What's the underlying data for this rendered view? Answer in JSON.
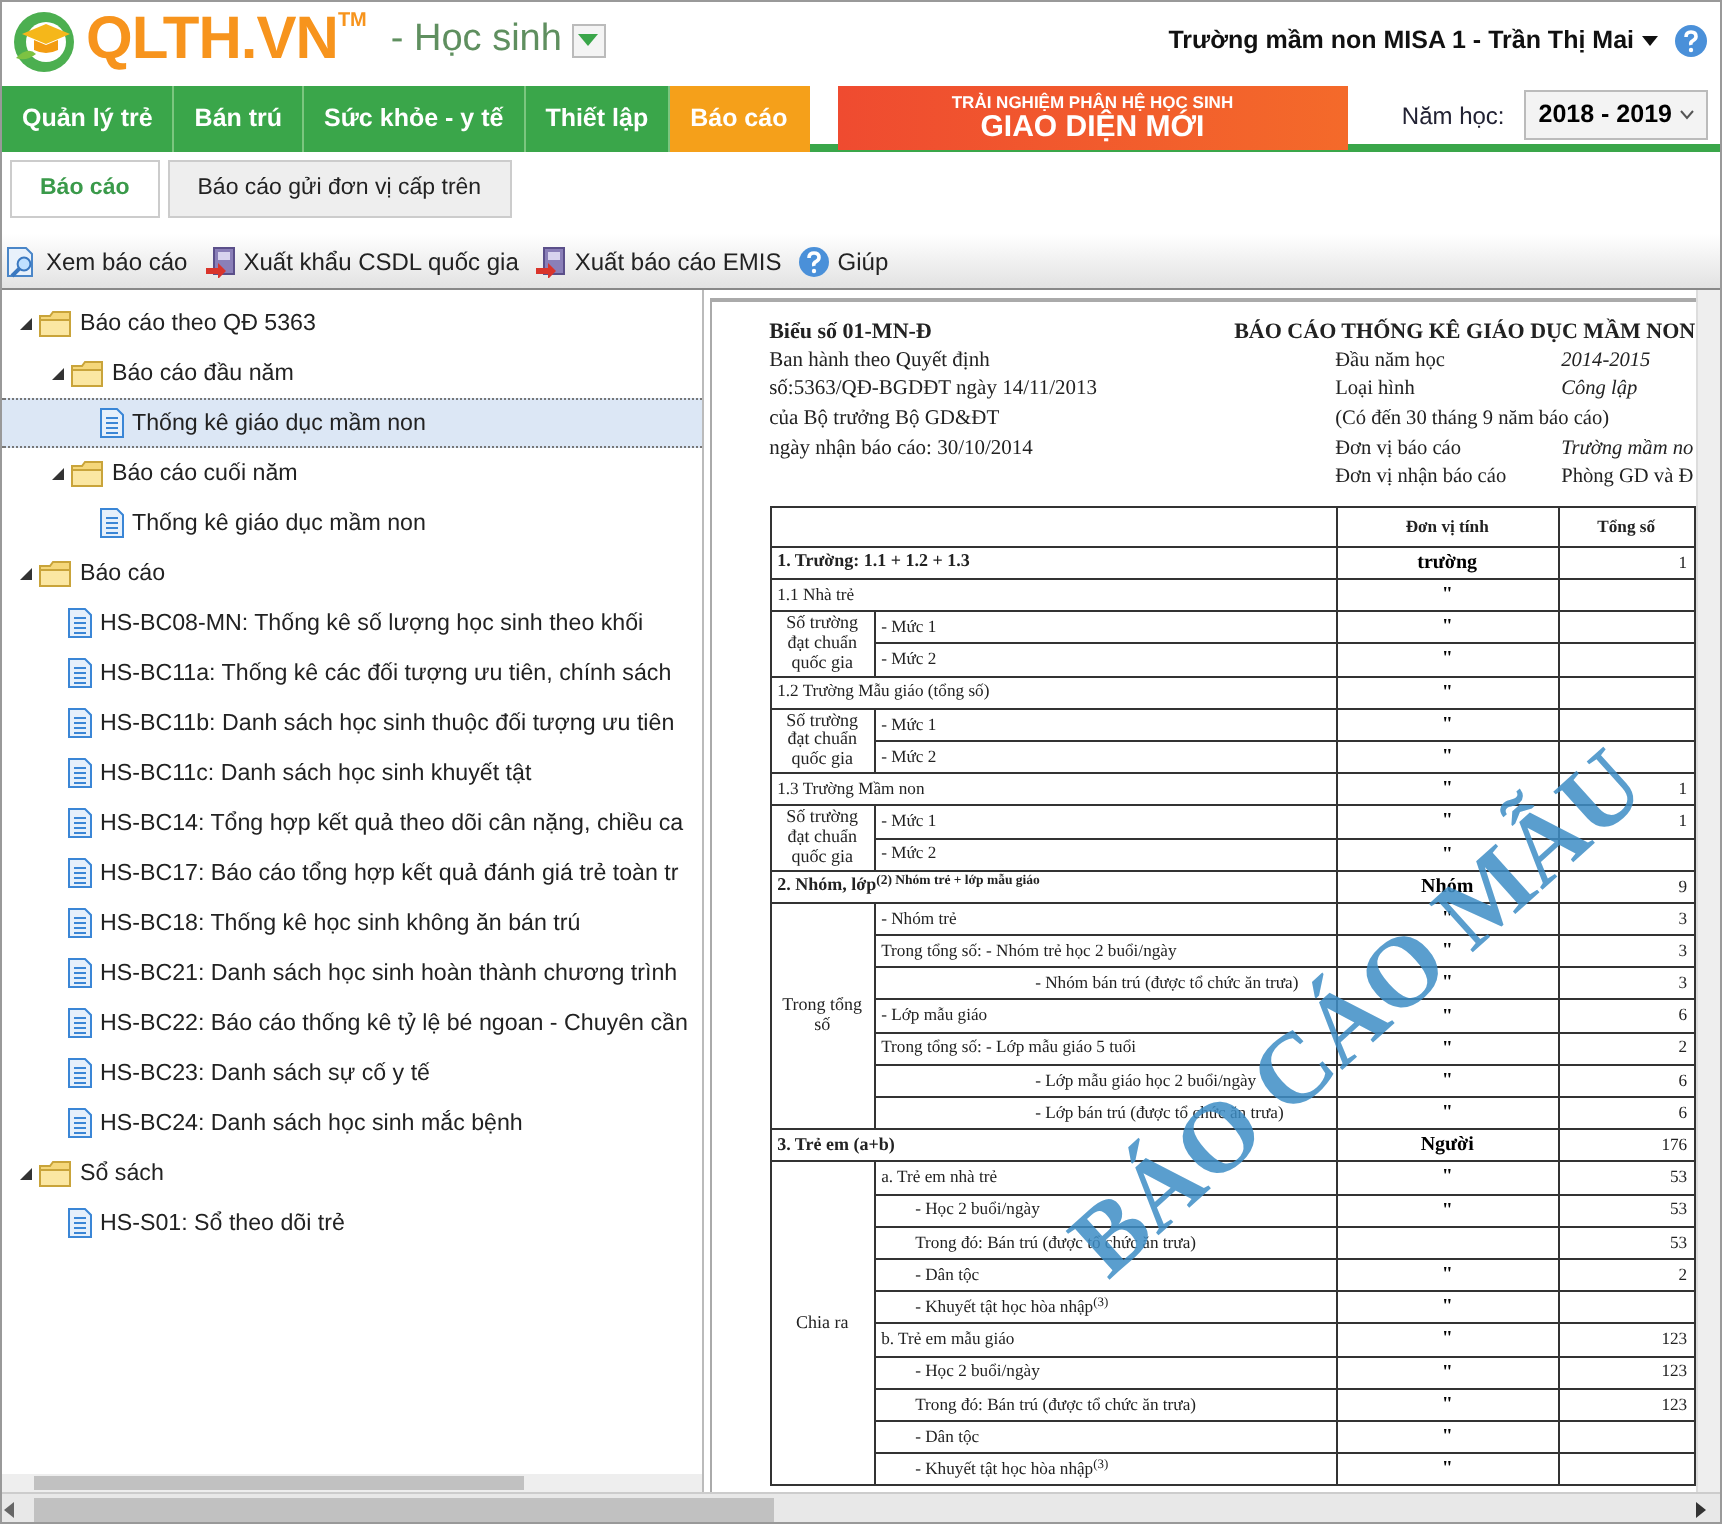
{
  "header": {
    "logo": "QLTH.VN",
    "trademark": "TM",
    "module": "- Học sinh",
    "user": "Trường mầm non MISA 1 - Trần Thị Mai"
  },
  "nav_tabs": [
    {
      "label": "Quản lý trẻ",
      "selected": false
    },
    {
      "label": "Bán trú",
      "selected": false
    },
    {
      "label": "Sức khỏe - y tế",
      "selected": false
    },
    {
      "label": "Thiết lập",
      "selected": false
    },
    {
      "label": "Báo cáo",
      "selected": true
    }
  ],
  "banner": {
    "line_1": "TRẢI NGHIỆM PHÂN HỆ HỌC SINH",
    "line_2": "GIAO DIỆN MỚI"
  },
  "school_year": {
    "label": "Năm học:",
    "value": "2018 - 2019"
  },
  "sub_tabs": [
    {
      "label": "Báo cáo",
      "selected": true
    },
    {
      "label": "Báo cáo gửi đơn vị cấp trên",
      "selected": false
    }
  ],
  "toolbar": [
    {
      "label": "Xem báo cáo",
      "kind": "view"
    },
    {
      "label": "Xuất khẩu CSDL quốc gia",
      "kind": "export"
    },
    {
      "label": "Xuất báo cáo EMIS",
      "kind": "export"
    },
    {
      "label": "Giúp",
      "kind": "help"
    }
  ],
  "tree": [
    {
      "label": "Báo cáo theo QĐ 5363",
      "kind": "folder",
      "expanded": true,
      "selected": false,
      "children": [
        {
          "label": "Báo cáo đầu năm",
          "kind": "folder",
          "expanded": true,
          "selected": false,
          "children": [
            {
              "label": "Thống kê giáo dục mầm non",
              "kind": "report",
              "selected": true
            }
          ]
        },
        {
          "label": "Báo cáo cuối năm",
          "kind": "folder",
          "expanded": true,
          "selected": false,
          "children": [
            {
              "label": "Thống kê giáo dục mầm non",
              "kind": "report",
              "selected": false
            }
          ]
        }
      ]
    },
    {
      "label": "Báo cáo",
      "kind": "folder",
      "expanded": true,
      "selected": false,
      "children": [
        {
          "label": "HS-BC08-MN: Thống kê số lượng học sinh theo khối",
          "kind": "report",
          "selected": false
        },
        {
          "label": "HS-BC11a: Thống kê các đối tượng ưu tiên, chính sách",
          "kind": "report",
          "selected": false
        },
        {
          "label": "HS-BC11b: Danh sách học sinh thuộc đối tượng ưu tiên",
          "kind": "report",
          "selected": false
        },
        {
          "label": "HS-BC11c: Danh sách học sinh khuyết tật",
          "kind": "report",
          "selected": false
        },
        {
          "label": "HS-BC14: Tổng hợp kết quả theo dõi cân nặng, chiều ca",
          "kind": "report",
          "selected": false
        },
        {
          "label": "HS-BC17: Báo cáo tổng hợp kết quả đánh giá trẻ toàn tr",
          "kind": "report",
          "selected": false
        },
        {
          "label": "HS-BC18: Thống kê học sinh không ăn bán trú",
          "kind": "report",
          "selected": false
        },
        {
          "label": "HS-BC21: Danh sách học sinh hoàn thành chương trình",
          "kind": "report",
          "selected": false
        },
        {
          "label": "HS-BC22: Báo cáo thống kê tỷ lệ bé ngoan - Chuyên cần",
          "kind": "report",
          "selected": false
        },
        {
          "label": "HS-BC23: Danh sách sự cố y tế",
          "kind": "report",
          "selected": false
        },
        {
          "label": "HS-BC24: Danh sách học sinh mắc bệnh",
          "kind": "report",
          "selected": false
        }
      ]
    },
    {
      "label": "Sổ sách",
      "kind": "folder",
      "expanded": true,
      "selected": false,
      "children": [
        {
          "label": "HS-S01: Sổ theo dõi trẻ",
          "kind": "report",
          "selected": false
        }
      ]
    }
  ],
  "report": {
    "form_no": "Biểu số 01-MN-Đ",
    "title": "BÁO CÁO THỐNG KÊ GIÁO DỤC MẦM NON",
    "issued_lines": [
      "Ban hành theo Quyết định",
      "số:5363/QĐ-BGDĐT ngày 14/11/2013",
      "của Bộ trưởng Bộ GD&ĐT",
      "ngày nhận báo cáo: 30/10/2014"
    ],
    "info": [
      {
        "label": "Đầu năm học",
        "value": "2014-2015"
      },
      {
        "label": "Loại hình",
        "value": "Công lập"
      },
      {
        "label": "(Có đến 30 tháng 9 năm báo cáo)"
      },
      {
        "label": "Đơn vị báo cáo",
        "value": "Trường mầm no"
      },
      {
        "label": "Đơn vị nhận báo cáo",
        "value": "Phòng GD và Đ",
        "plain": true
      }
    ],
    "columns": [
      "Đơn vị tính",
      "Tổng số"
    ],
    "rows": [
      {
        "kind": "section",
        "label": "1. Trường: 1.1 + 1.2 + 1.3",
        "unit": "trường",
        "total": "1"
      },
      {
        "kind": "subsection",
        "label": "1.1 Nhà trẻ",
        "unit": "\""
      },
      {
        "kind": "group",
        "label": "Số trường đạt chuẩn quốc gia",
        "items": [
          {
            "kind": "line",
            "label": "-  Mức 1",
            "unit": "\""
          },
          {
            "kind": "line",
            "label": "-  Mức 2",
            "unit": "\""
          }
        ]
      },
      {
        "kind": "subsection",
        "label": "1.2 Trường Mẫu giáo (tổng số)",
        "unit": "\""
      },
      {
        "kind": "group",
        "label": "Số trường đạt chuẩn quốc gia",
        "items": [
          {
            "kind": "line",
            "label": "-  Mức 1",
            "unit": "\""
          },
          {
            "kind": "line",
            "label": "-  Mức 2",
            "unit": "\""
          }
        ]
      },
      {
        "kind": "subsection",
        "label": "1.3 Trường Mầm non",
        "unit": "\"",
        "total": "1"
      },
      {
        "kind": "group",
        "label": "Số trường đạt chuẩn quốc gia",
        "items": [
          {
            "kind": "line",
            "label": "-  Mức 1",
            "unit": "\"",
            "total": "1"
          },
          {
            "kind": "line",
            "label": "-  Mức 2",
            "unit": "\""
          }
        ]
      },
      {
        "kind": "section",
        "label": "2. Nhóm, lớp$^{(2) Nhóm trẻ + lớp mẫu giáo}$",
        "unit": "Nhóm",
        "total": "9"
      },
      {
        "kind": "group",
        "label": "Trong tổng số",
        "items": [
          {
            "kind": "line",
            "label": "- Nhóm trẻ",
            "unit": "\"",
            "total": "3"
          },
          {
            "kind": "line",
            "label": "Trong tổng số: - Nhóm trẻ học 2 buổi/ngày",
            "unit": "\"",
            "total": "3"
          },
          {
            "kind": "continued",
            "label": "- Nhóm bán trú (được tổ chức ăn trưa)",
            "unit": "\"",
            "total": "3"
          },
          {
            "kind": "line",
            "label": "- Lớp mẫu giáo",
            "unit": "\"",
            "total": "6"
          },
          {
            "kind": "line",
            "label": "Trong tổng số:  - Lớp mẫu giáo 5 tuổi",
            "unit": "\"",
            "total": "2"
          },
          {
            "kind": "continued",
            "label": "- Lớp mẫu giáo học 2 buổi/ngày",
            "unit": "\"",
            "total": "6"
          },
          {
            "kind": "continued",
            "label": "- Lớp bán trú (được tổ chức ăn trưa)",
            "unit": "\"",
            "total": "6"
          }
        ]
      },
      {
        "kind": "section",
        "label": "3. Trẻ em (a+b)",
        "unit": "Người",
        "total": "176"
      },
      {
        "kind": "group",
        "label": "Chia ra",
        "items": [
          {
            "kind": "line",
            "label": "a. Trẻ em nhà trẻ",
            "unit": "\"",
            "total": "53"
          },
          {
            "kind": "sub",
            "label": "- Học 2 buổi/ngày",
            "unit": "\"",
            "total": "53"
          },
          {
            "kind": "sub",
            "label": " Trong đó: Bán trú (được tổ chức ăn trưa)",
            "total": "53"
          },
          {
            "kind": "sub",
            "label": "- Dân tộc",
            "unit": "\"",
            "total": "2"
          },
          {
            "kind": "sub",
            "label": "- Khuyết tật học hòa nhập$^{(3)}$",
            "unit": "\""
          },
          {
            "kind": "line",
            "label": "b. Trẻ em mẫu giáo",
            "unit": "\"",
            "total": "123"
          },
          {
            "kind": "sub",
            "label": "- Học 2 buổi/ngày",
            "unit": "\"",
            "total": "123"
          },
          {
            "kind": "sub",
            "label": " Trong đó: Bán trú (được tổ chức ăn trưa)",
            "unit": "\"",
            "total": "123"
          },
          {
            "kind": "sub",
            "label": "- Dân tộc",
            "unit": "\""
          },
          {
            "kind": "sub",
            "label": "- Khuyết tật học hòa nhập$^{(3)}$",
            "unit": "\""
          }
        ]
      }
    ],
    "stamp": "BÁO CÁO MẪU"
  }
}
